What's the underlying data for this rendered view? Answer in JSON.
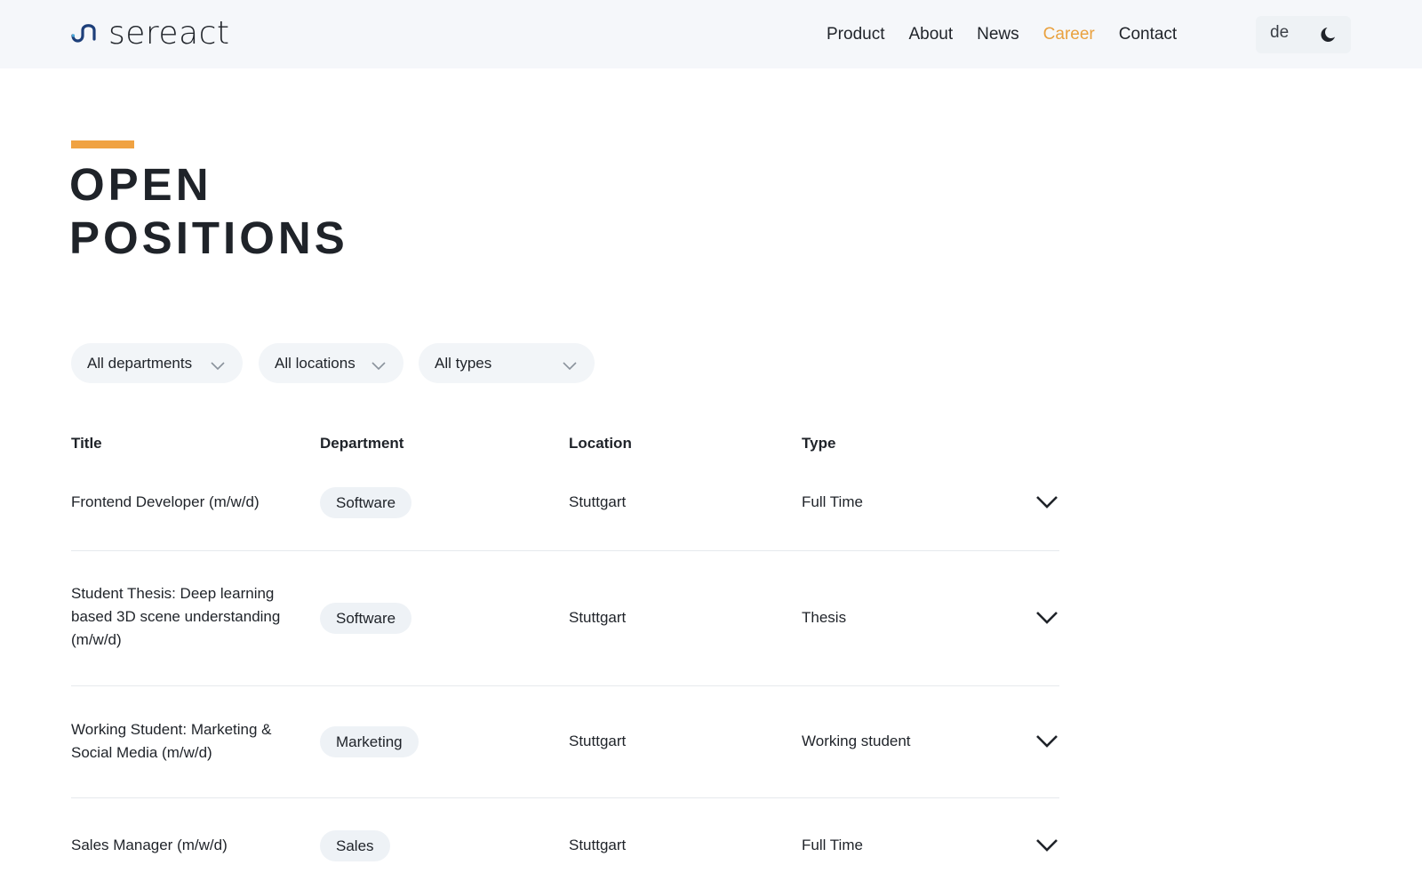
{
  "brand": {
    "name": "sereact",
    "accent_color": "#f0a242",
    "nav_active_color": "#e9a13f"
  },
  "nav": {
    "items": [
      {
        "label": "Product",
        "active": false
      },
      {
        "label": "About",
        "active": false
      },
      {
        "label": "News",
        "active": false
      },
      {
        "label": "Career",
        "active": true
      },
      {
        "label": "Contact",
        "active": false
      }
    ],
    "language": "de",
    "theme_toggle_icon": "moon-icon"
  },
  "page": {
    "heading_line1": "OPEN",
    "heading_line2": "POSITIONS"
  },
  "filters": [
    {
      "label": "All departments",
      "icon": "chevron-down-icon"
    },
    {
      "label": "All locations",
      "icon": "chevron-down-icon"
    },
    {
      "label": "All types",
      "icon": "chevron-down-icon"
    }
  ],
  "table": {
    "columns": [
      "Title",
      "Department",
      "Location",
      "Type"
    ],
    "rows": [
      {
        "title": "Frontend Developer (m/w/d)",
        "department": "Software",
        "location": "Stuttgart",
        "type": "Full Time"
      },
      {
        "title": "Student Thesis: Deep learning based 3D scene understanding (m/w/d)",
        "department": "Software",
        "location": "Stuttgart",
        "type": "Thesis"
      },
      {
        "title": "Working Student: Marketing & Social Media (m/w/d)",
        "department": "Marketing",
        "location": "Stuttgart",
        "type": "Working student"
      },
      {
        "title": "Sales Manager (m/w/d)",
        "department": "Sales",
        "location": "Stuttgart",
        "type": "Full Time"
      }
    ]
  }
}
